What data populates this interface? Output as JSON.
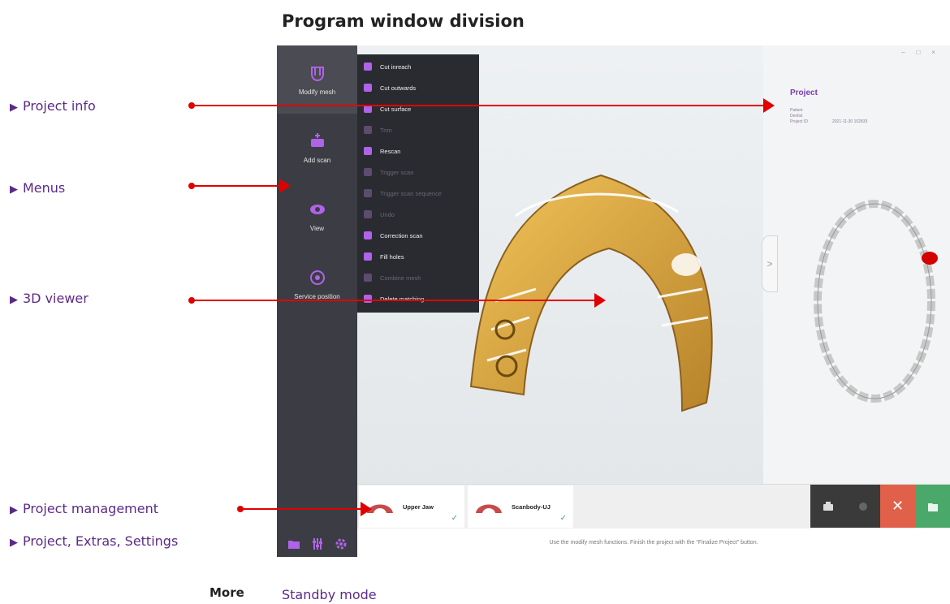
{
  "title": "Program window division",
  "legend": [
    {
      "id": "project-info",
      "label": "Project info"
    },
    {
      "id": "menus",
      "label": "Menus"
    },
    {
      "id": "viewer",
      "label": "3D viewer"
    },
    {
      "id": "management",
      "label": "Project management"
    },
    {
      "id": "extras",
      "label": "Project, Extras, Settings"
    }
  ],
  "footer": {
    "more": "More",
    "link": "Standby mode"
  },
  "sidebar": {
    "items": [
      {
        "label": "Modify mesh",
        "icon": "jaw-mesh-icon"
      },
      {
        "label": "Add scan",
        "icon": "add-scan-icon"
      },
      {
        "label": "View",
        "icon": "eye-icon"
      },
      {
        "label": "Service position",
        "icon": "service-position-icon"
      }
    ],
    "bottom_icons": [
      "folder-icon",
      "sliders-icon",
      "gear-icon"
    ]
  },
  "submenu": {
    "items": [
      {
        "label": "Cut inreach",
        "enabled": true
      },
      {
        "label": "Cut outwards",
        "enabled": true
      },
      {
        "label": "Cut surface",
        "enabled": true
      },
      {
        "label": "Trim",
        "enabled": false
      },
      {
        "label": "Rescan",
        "enabled": true
      },
      {
        "label": "Trigger scan",
        "enabled": false
      },
      {
        "label": "Trigger scan sequence",
        "enabled": false
      },
      {
        "label": "Undo",
        "enabled": false
      },
      {
        "label": "Correction scan",
        "enabled": true
      },
      {
        "label": "Fill holes",
        "enabled": true
      },
      {
        "label": "Combine mesh",
        "enabled": false
      },
      {
        "label": "Delete matching",
        "enabled": true
      }
    ]
  },
  "project_panel": {
    "title": "Project",
    "lines": [
      "Patient",
      "Dentist",
      "Project ID"
    ],
    "project_id_value": "2021-11-30 102833",
    "window_controls": [
      "–",
      "□",
      "×"
    ]
  },
  "scans": [
    {
      "name": "Upper Jaw",
      "checked": true
    },
    {
      "name": "Scanbody-UJ",
      "checked": true
    }
  ],
  "actions": [
    {
      "icon": "scanner-icon",
      "color": "#3a3a3a"
    },
    {
      "icon": "camera-icon",
      "color": "#3a3a3a"
    },
    {
      "icon": "close-icon",
      "color": "#e0604a",
      "symbol": "✕"
    },
    {
      "icon": "finalize-icon",
      "color": "#4aa86a"
    }
  ],
  "hint": "Use the modify mesh functions. Finish the project with the \"Finalize Project\" button.",
  "colors": {
    "accent": "#7a3bb0",
    "arrow": "#e00000",
    "legend": "#5b2a86",
    "jaw": "#d6a23c"
  }
}
